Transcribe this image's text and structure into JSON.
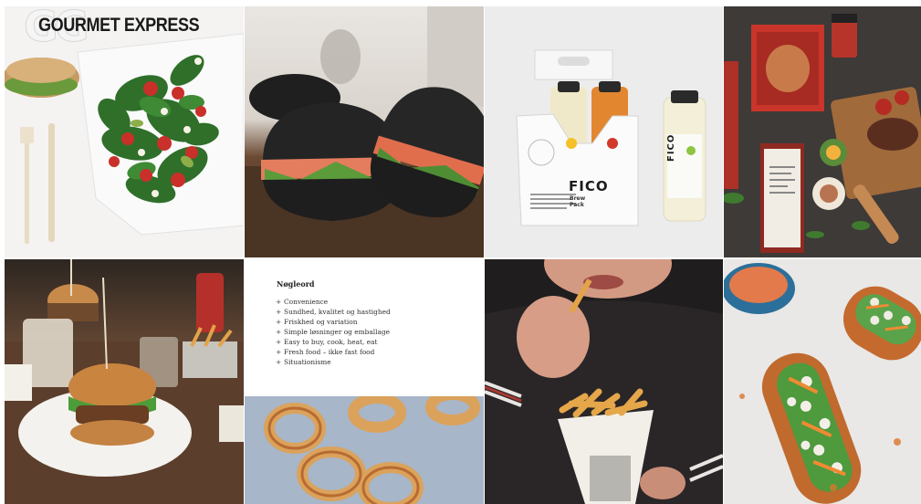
{
  "brand": {
    "logo_mark": "GG",
    "name": "GOURMET EXPRESS"
  },
  "keywords": {
    "title": "Nøgleord",
    "items": [
      "Convenience",
      "Sundhed, kvalitet og hastighed",
      "Friskhed og variation",
      "Simple løsninger og emballage",
      "Easy to buy, cook, heat, eat",
      "Fresh food – ikke fast food",
      "Situationisme"
    ]
  },
  "product": {
    "box_label": "FICO",
    "box_sub_1": "Brew",
    "box_sub_2": "Pack",
    "bottle_label": "FICO"
  },
  "colors": {
    "background": "#ffffff",
    "logo_text": "#1a1a1a",
    "juice_orange": "#e2862f",
    "fico_green": "#8cc540",
    "fico_red": "#d2392b"
  }
}
